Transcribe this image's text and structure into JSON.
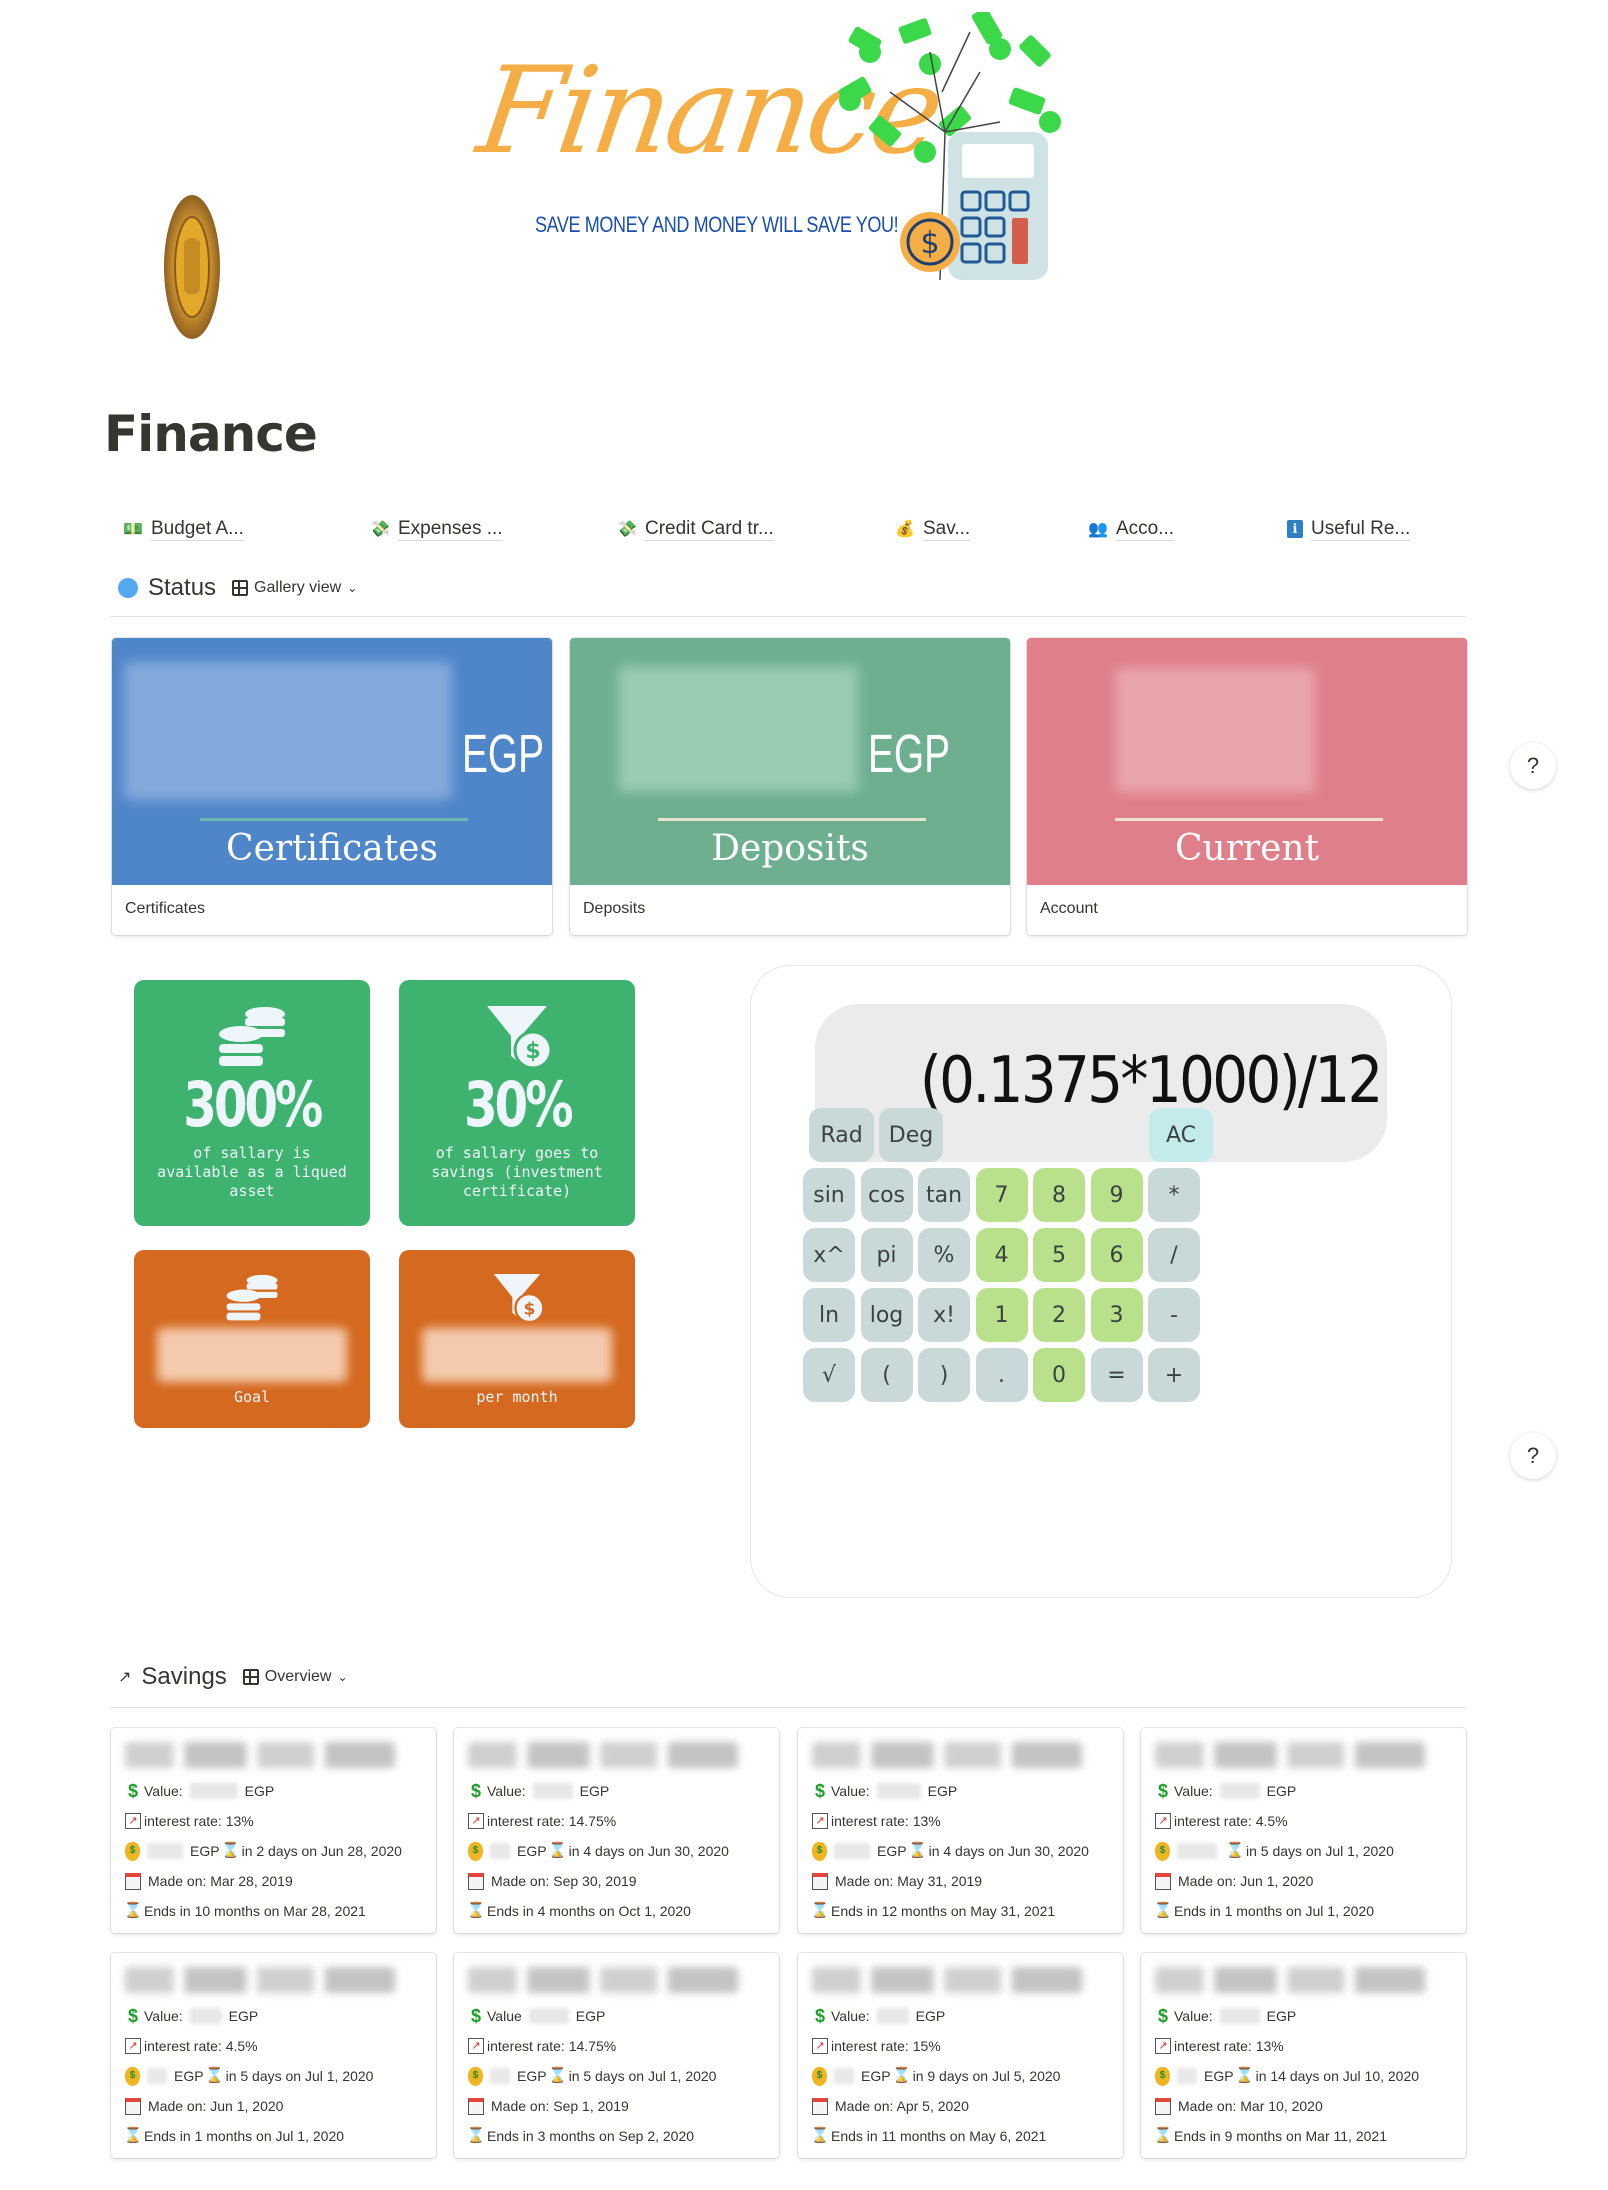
{
  "banner": {
    "script_title": "Finance",
    "tagline": "SAVE MONEY AND MONEY WILL SAVE YOU!"
  },
  "page": {
    "title": "Finance"
  },
  "nav_links": [
    {
      "icon": "money-bill-icon",
      "glyph": "💵",
      "label": "Budget A..."
    },
    {
      "icon": "money-wings-icon",
      "glyph": "💸",
      "label": "Expenses ..."
    },
    {
      "icon": "money-wings-icon",
      "glyph": "💸",
      "label": "Credit Card tr..."
    },
    {
      "icon": "money-bag-icon",
      "glyph": "💰",
      "label": "Sav..."
    },
    {
      "icon": "people-icon",
      "glyph": "👥",
      "label": "Acco..."
    },
    {
      "icon": "info-icon",
      "glyph": "ℹ",
      "label": "Useful Re..."
    }
  ],
  "status_section": {
    "title": "Status",
    "view_label": "Gallery view",
    "cards": [
      {
        "cover_label": "Certificates",
        "currency": "EGP",
        "caption": "Certificates",
        "color": "#4f86c9",
        "line_color": "#6fb6b3"
      },
      {
        "cover_label": "Deposits",
        "currency": "EGP",
        "caption": "Deposits",
        "color": "#6eaf8f",
        "line_color": "#e6e3cd"
      },
      {
        "cover_label": "Current",
        "currency": "",
        "caption": "Account",
        "color": "#df7f89",
        "line_color": "#eee0d0"
      }
    ]
  },
  "stat_tiles": [
    {
      "value": "300%",
      "text": "of sallary is available as a liqued asset",
      "icon": "coins-icon",
      "color": "#3eb370"
    },
    {
      "value": "30%",
      "text": "of sallary goes to savings (investment certificate)",
      "icon": "funnel-dollar-icon",
      "color": "#3eb370"
    },
    {
      "value": "",
      "text": "Goal",
      "icon": "coins-icon",
      "color": "#d4691f"
    },
    {
      "value": "",
      "text": "per month",
      "icon": "funnel-dollar-icon",
      "color": "#d4691f"
    }
  ],
  "calculator": {
    "display": "(0.1375*1000)/12",
    "mode_keys": [
      "Rad",
      "Deg"
    ],
    "clear_key": "AC",
    "rows": [
      [
        "sin",
        "cos",
        "tan",
        "7",
        "8",
        "9",
        "*"
      ],
      [
        "x^",
        "pi",
        "%",
        "4",
        "5",
        "6",
        "/"
      ],
      [
        "ln",
        "log",
        "x!",
        "1",
        "2",
        "3",
        "-"
      ],
      [
        "√",
        "(",
        ")",
        ".",
        "0",
        "=",
        "+"
      ]
    ],
    "numeric_keys": [
      "0",
      "1",
      "2",
      "3",
      "4",
      "5",
      "6",
      "7",
      "8",
      "9"
    ]
  },
  "help_label": "?",
  "savings_section": {
    "title": "Savings",
    "view_label": "Overview",
    "cards": [
      {
        "value_label": "Value:",
        "currency": "EGP",
        "interest": "interest rate: 13%",
        "payout": "in 2 days on Jun 28, 2020",
        "payout_currency": "EGP",
        "made_on": "Made on: Mar 28, 2019",
        "ends": "Ends in 10 months on Mar 28, 2021"
      },
      {
        "value_label": "Value:",
        "currency": "EGP",
        "interest": "interest rate: 14.75%",
        "payout": "in 4 days on Jun 30, 2020",
        "payout_currency": "EGP",
        "made_on": "Made on: Sep 30, 2019",
        "ends": "Ends in 4 months on Oct 1, 2020"
      },
      {
        "value_label": "Value:",
        "currency": "EGP",
        "interest": "interest rate: 13%",
        "payout": "in 4 days on Jun 30, 2020",
        "payout_currency": "EGP",
        "made_on": "Made on: May 31, 2019",
        "ends": "Ends in 12 months on May 31, 2021"
      },
      {
        "value_label": "Value:",
        "currency": "EGP",
        "interest": "interest rate: 4.5%",
        "payout": "in 5 days on Jul 1, 2020",
        "payout_currency": "",
        "made_on": "Made on: Jun 1, 2020",
        "ends": "Ends in 1 months on Jul 1, 2020"
      },
      {
        "value_label": "Value:",
        "currency": "EGP",
        "interest": "interest rate: 4.5%",
        "payout": "in 5 days on Jul 1, 2020",
        "payout_currency": "EGP",
        "made_on": "Made on: Jun 1, 2020",
        "ends": "Ends in 1 months on Jul 1, 2020"
      },
      {
        "value_label": "Value",
        "currency": "EGP",
        "interest": "interest rate: 14.75%",
        "payout": "in 5 days on Jul 1, 2020",
        "payout_currency": "EGP",
        "made_on": "Made on: Sep 1, 2019",
        "ends": "Ends in 3 months on Sep 2, 2020"
      },
      {
        "value_label": "Value:",
        "currency": "EGP",
        "interest": "interest rate: 15%",
        "payout": "in 9 days on Jul 5, 2020",
        "payout_currency": "EGP",
        "made_on": "Made on: Apr 5, 2020",
        "ends": "Ends in 11 months on May 6, 2021"
      },
      {
        "value_label": "Value:",
        "currency": "EGP",
        "interest": "interest rate: 13%",
        "payout": "in 14 days on Jul 10, 2020",
        "payout_currency": "EGP",
        "made_on": "Made on: Mar 10, 2020",
        "ends": "Ends in 9 months on Mar 11, 2021"
      }
    ]
  }
}
